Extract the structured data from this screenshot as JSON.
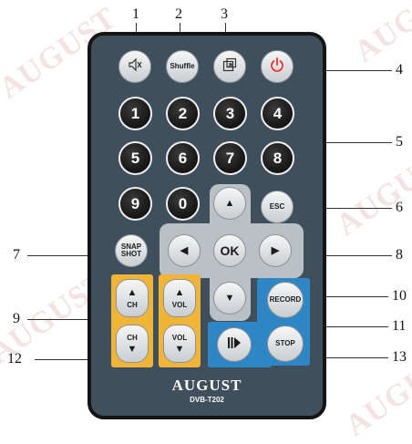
{
  "watermark": {
    "text": "AUGUST"
  },
  "callouts": [
    "1",
    "2",
    "3",
    "4",
    "5",
    "6",
    "7",
    "8",
    "9",
    "10",
    "11",
    "12",
    "13"
  ],
  "buttons": {
    "mute_icon": "speaker-mute-icon",
    "shuffle": "Shuffle",
    "pip_icon": "picture-in-picture-icon",
    "power_icon": "power-icon",
    "digits": [
      "1",
      "2",
      "3",
      "4",
      "5",
      "6",
      "7",
      "8",
      "9",
      "0"
    ],
    "esc": "ESC",
    "snap_line1": "SNAP",
    "snap_line2": "SHOT",
    "ok": "OK",
    "ch": "CH",
    "vol": "VOL",
    "record": "RECORD",
    "stop": "STOP",
    "play_icon": "play-pause-icon",
    "up": "▲",
    "down": "▼",
    "left": "◀",
    "right": "▶"
  },
  "brand": {
    "logo": "AUGUST",
    "model": "DVB-T202"
  },
  "colors": {
    "body": "#3f4f5c",
    "power": "#e8332c",
    "yellow_panel": "#f0b437",
    "blue_panel": "#2f86c4"
  }
}
